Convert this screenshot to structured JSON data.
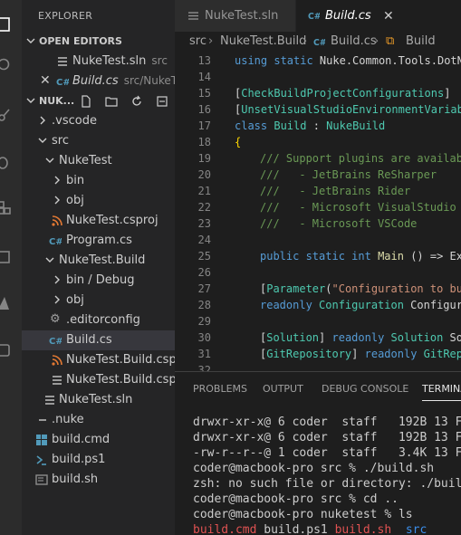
{
  "sidebar": {
    "title": "EXPLORER",
    "open_editors": {
      "header": "OPEN EDITORS",
      "items": [
        {
          "name": "NukeTest.sln",
          "detail": "src"
        },
        {
          "name": "Build.cs",
          "detail": "src/NukeT..."
        }
      ]
    },
    "workspace": {
      "header": "NUK...",
      "tree": [
        "NukeTest",
        ".vscode",
        "src",
        "NukeTest",
        "bin",
        "obj",
        "NukeTest.csproj",
        "Program.cs",
        "NukeTest.Build",
        "bin / Debug",
        "obj",
        ".editorconfig",
        "Build.cs",
        "NukeTest.Build.csp...",
        "NukeTest.Build.csp...",
        "NukeTest.sln",
        ".nuke",
        "build.cmd",
        "build.ps1",
        "build.sh"
      ]
    }
  },
  "tabs": [
    {
      "label": "NukeTest.sln"
    },
    {
      "label": "Build.cs"
    }
  ],
  "breadcrumb": [
    "src",
    "NukeTest.Build",
    "Build.cs",
    "Build"
  ],
  "code": {
    "line_numbers": [
      "13",
      "14",
      "15",
      "16",
      "17",
      "18",
      "19",
      "20",
      "21",
      "22",
      "23",
      "24",
      "25",
      "26",
      "27",
      "28",
      "29",
      "30",
      "31",
      "32"
    ],
    "tokens": {
      "l13a": "using static",
      "l13b": " Nuke.Common.Tools.DotN",
      "l15a": "[",
      "l15b": "CheckBuildProjectConfigurations",
      "l15c": "]",
      "l16a": "[",
      "l16b": "UnsetVisualStudioEnvironmentVariab",
      "l17a": "class",
      "l17b": "Build",
      "l17c": " : ",
      "l17d": "NukeBuild",
      "l18": "{",
      "l19": "/// Support plugins are availab",
      "l20": "///   - JetBrains ReSharper",
      "l21": "///   - JetBrains Rider",
      "l22": "///   - Microsoft VisualStudio",
      "l23": "///   - Microsoft VSCode",
      "l25a": "public static int",
      "l25b": "Main",
      "l25c": " () => Ex",
      "l27a": "[",
      "l27b": "Parameter",
      "l27c": "(",
      "l27d": "\"Configuration to bu",
      "l28a": "readonly",
      "l28b": "Configuration",
      "l28c": " Configur",
      "l30a": "[",
      "l30b": "Solution",
      "l30c": "]",
      "l30d": "readonly",
      "l30e": "Solution",
      "l30f": " So",
      "l31a": "[",
      "l31b": "GitRepository",
      "l31c": "]",
      "l31d": "readonly",
      "l31e": "GitRep"
    }
  },
  "panel": {
    "tabs": [
      "PROBLEMS",
      "OUTPUT",
      "DEBUG CONSOLE",
      "TERMINA"
    ],
    "terminal": [
      "drwxr-xr-x@ 6 coder  staff   192B 13 F",
      "drwxr-xr-x@ 6 coder  staff   192B 13 F",
      "-rw-r--r--@ 1 coder  staff   3.4K 13 F",
      "coder@macbook-pro src % ./build.sh",
      "zsh: no such file or directory: ./buil",
      "coder@macbook-pro src % cd ..",
      "coder@macbook-pro nuketest % ls"
    ],
    "ls_output": [
      "build.cmd",
      "build.ps1",
      "build.sh",
      "src"
    ]
  },
  "colors": {
    "accent_csharp": "#519aba",
    "rss": "#e37933",
    "selection": "#37373d"
  }
}
